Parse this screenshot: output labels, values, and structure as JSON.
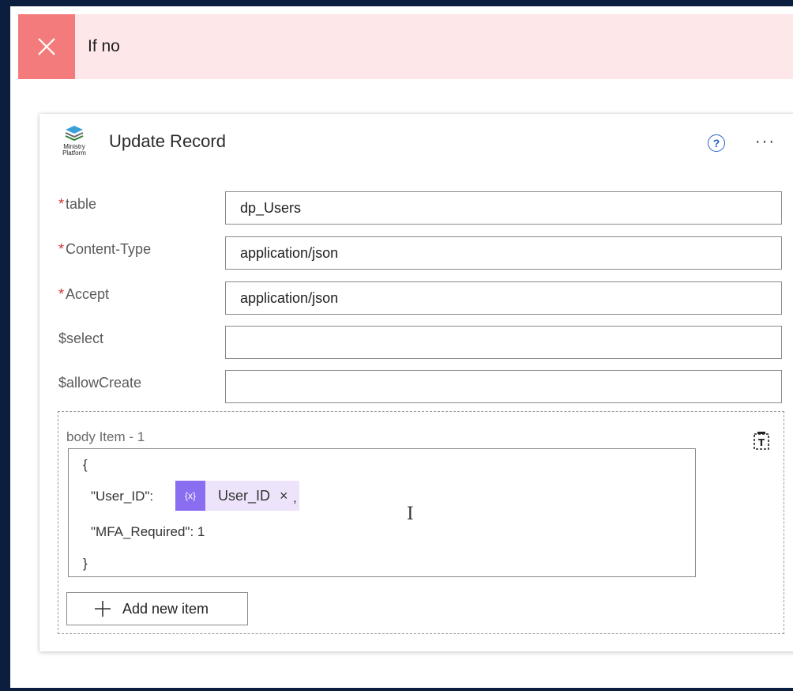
{
  "condition_bar": {
    "title": "If no",
    "close_icon": "close-icon",
    "accent": "#f47b7b",
    "background": "#fde7e9"
  },
  "action_card": {
    "title": "Update Record",
    "logo_text": "Ministry\nPlatform",
    "help_icon": "?",
    "more_icon": "···"
  },
  "fields": [
    {
      "label": "table",
      "required": true,
      "value": "dp_Users"
    },
    {
      "label": "Content-Type",
      "required": true,
      "value": "application/json"
    },
    {
      "label": "Accept",
      "required": true,
      "value": "application/json"
    },
    {
      "label": "$select",
      "required": false,
      "value": ""
    },
    {
      "label": "$allowCreate",
      "required": false,
      "value": ""
    }
  ],
  "body": {
    "label": "body Item - 1",
    "lines": {
      "open": "{",
      "user_key": "\"User_ID\":",
      "comma": ",",
      "mfa": "\"MFA_Required\": 1",
      "close": "}"
    },
    "token": {
      "icon_text": "{x}",
      "label": "User_ID",
      "remove": "×",
      "color": "#8a6df0"
    },
    "add_button_label": "Add new item"
  }
}
